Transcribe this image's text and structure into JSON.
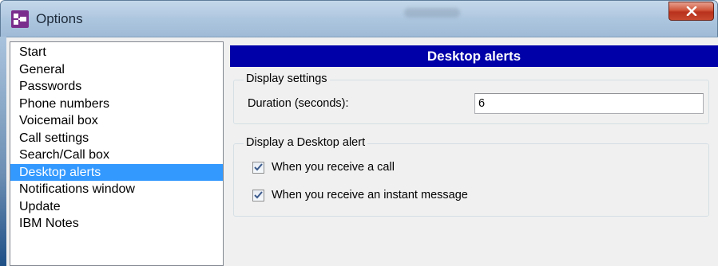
{
  "window": {
    "title": "Options",
    "icon": "app-options-icon",
    "close_icon": "close-icon"
  },
  "nav": {
    "items": [
      {
        "label": "Start",
        "selected": false
      },
      {
        "label": "General",
        "selected": false
      },
      {
        "label": "Passwords",
        "selected": false
      },
      {
        "label": "Phone numbers",
        "selected": false
      },
      {
        "label": "Voicemail box",
        "selected": false
      },
      {
        "label": "Call settings",
        "selected": false
      },
      {
        "label": "Search/Call box",
        "selected": false
      },
      {
        "label": "Desktop alerts",
        "selected": true
      },
      {
        "label": "Notifications window",
        "selected": false
      },
      {
        "label": "Update",
        "selected": false
      },
      {
        "label": "IBM Notes",
        "selected": false
      }
    ]
  },
  "pane": {
    "header": "Desktop alerts",
    "display_settings": {
      "legend": "Display settings",
      "duration_label": "Duration (seconds):",
      "duration_value": "6"
    },
    "desktop_alert": {
      "legend": "Display a Desktop alert",
      "options": [
        {
          "label": "When you receive a call",
          "checked": true
        },
        {
          "label": "When you receive an instant message",
          "checked": true
        }
      ]
    }
  },
  "colors": {
    "header_bg": "#0000a8",
    "selection_bg": "#3399ff",
    "close_button": "#c8492f"
  }
}
